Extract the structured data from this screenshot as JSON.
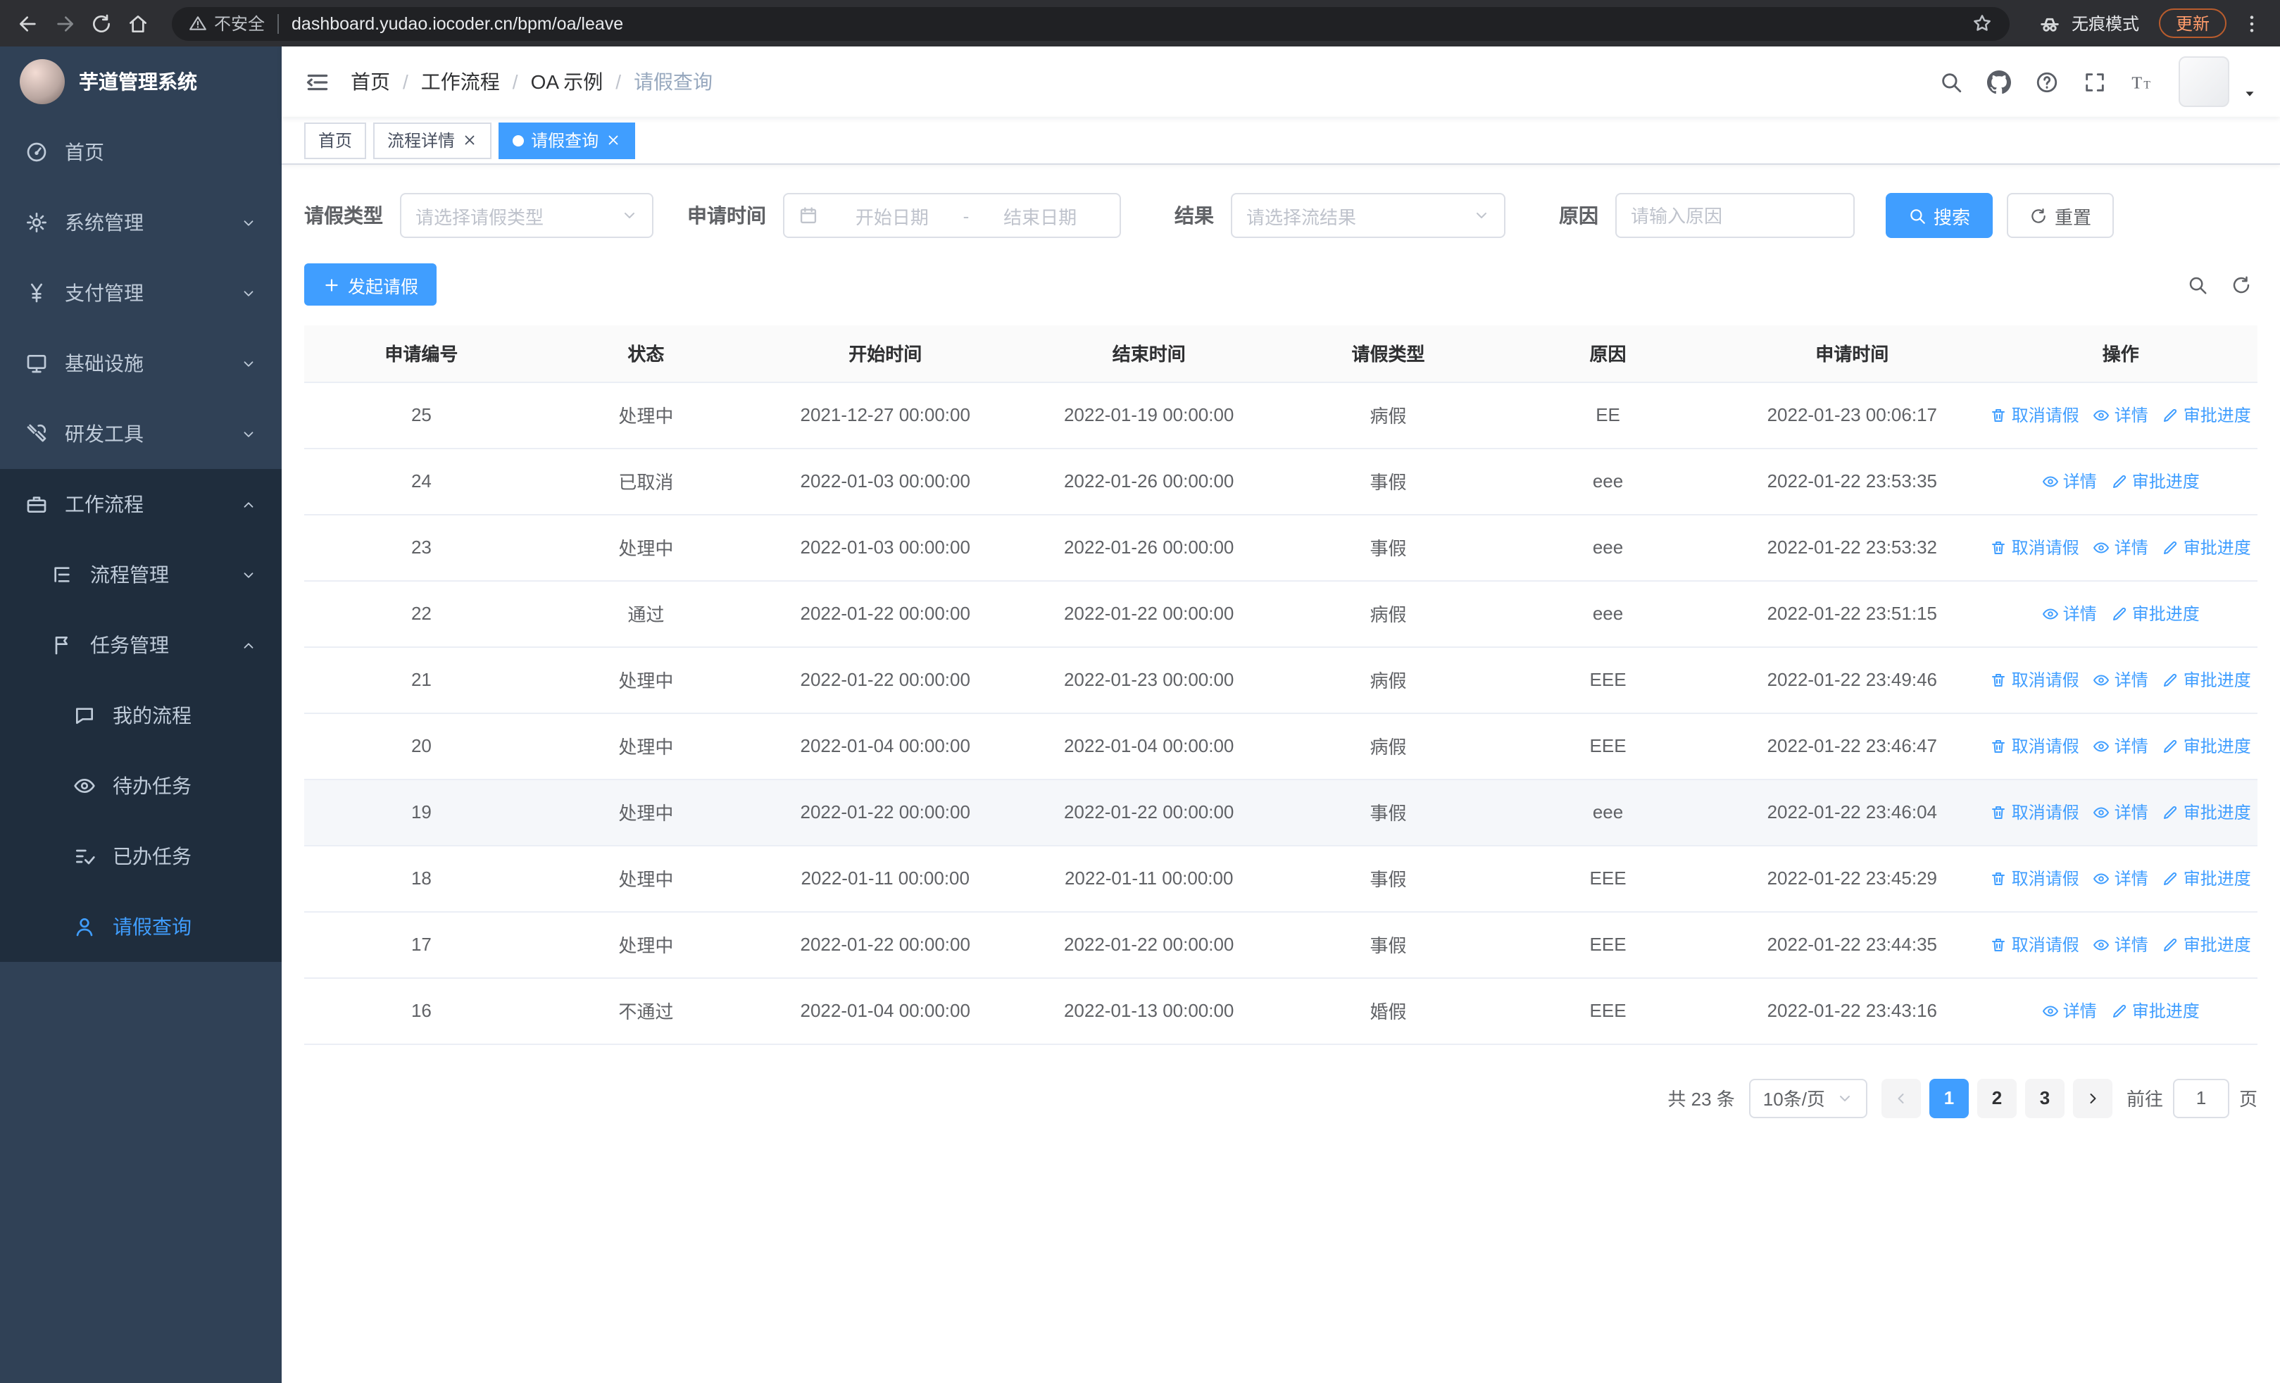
{
  "colors": {
    "primary": "#409eff"
  },
  "browser": {
    "security_warning": "不安全",
    "url": "dashboard.yudao.iocoder.cn/bpm/oa/leave",
    "incognito_label": "无痕模式",
    "update_label": "更新"
  },
  "sidebar": {
    "logo_title": "芋道管理系统",
    "items": [
      {
        "key": "home",
        "label": "首页",
        "icon": "home-icon",
        "level": 1
      },
      {
        "key": "system-mgmt",
        "label": "系统管理",
        "icon": "gear-icon",
        "level": 1,
        "chevron": "down"
      },
      {
        "key": "payment-mgmt",
        "label": "支付管理",
        "icon": "yen-icon",
        "level": 1,
        "chevron": "down"
      },
      {
        "key": "infrastructure",
        "label": "基础设施",
        "icon": "monitor-icon",
        "level": 1,
        "chevron": "down"
      },
      {
        "key": "dev-tools",
        "label": "研发工具",
        "icon": "tools-icon",
        "level": 1,
        "chevron": "down"
      },
      {
        "key": "workflow",
        "label": "工作流程",
        "icon": "briefcase-icon",
        "level": 1,
        "chevron": "up",
        "submenu": true
      },
      {
        "key": "process-mgmt",
        "label": "流程管理",
        "icon": "tree-icon",
        "level": 2,
        "chevron": "down",
        "submenu": true
      },
      {
        "key": "task-mgmt",
        "label": "任务管理",
        "icon": "flag-icon",
        "level": 2,
        "chevron": "up",
        "submenu": true
      },
      {
        "key": "my-process",
        "label": "我的流程",
        "icon": "chat-icon",
        "level": 3,
        "submenu": true
      },
      {
        "key": "todo-tasks",
        "label": "待办任务",
        "icon": "eye-icon",
        "level": 3,
        "submenu": true
      },
      {
        "key": "done-tasks",
        "label": "已办任务",
        "icon": "finished-icon",
        "level": 3,
        "submenu": true
      },
      {
        "key": "leave-query",
        "label": "请假查询",
        "icon": "user-icon",
        "level": 3,
        "submenu": true,
        "active": true
      }
    ]
  },
  "header": {
    "breadcrumbs": [
      "首页",
      "工作流程",
      "OA 示例",
      "请假查询"
    ]
  },
  "tabs": [
    {
      "label": "首页",
      "closable": false,
      "active": false
    },
    {
      "label": "流程详情",
      "closable": true,
      "active": false
    },
    {
      "label": "请假查询",
      "closable": true,
      "active": true
    }
  ],
  "filters": {
    "leave_type_label": "请假类型",
    "leave_type_placeholder": "请选择请假类型",
    "apply_time_label": "申请时间",
    "start_date_placeholder": "开始日期",
    "date_separator": "-",
    "end_date_placeholder": "结束日期",
    "result_label": "结果",
    "result_placeholder": "请选择流结果",
    "reason_label": "原因",
    "reason_placeholder": "请输入原因",
    "search_button": "搜索",
    "reset_button": "重置"
  },
  "toolbar": {
    "create_button": "发起请假"
  },
  "table": {
    "columns": [
      "申请编号",
      "状态",
      "开始时间",
      "结束时间",
      "请假类型",
      "原因",
      "申请时间",
      "操作"
    ],
    "action_meta": {
      "取消请假": {
        "icon": "delete-icon",
        "name": "cancel-leave-action"
      },
      "详情": {
        "icon": "view-icon",
        "name": "detail-action"
      },
      "审批进度": {
        "icon": "edit-icon",
        "name": "approval-progress-action"
      }
    },
    "rows": [
      {
        "id": "25",
        "status": "处理中",
        "start": "2021-12-27 00:00:00",
        "end": "2022-01-19 00:00:00",
        "type": "病假",
        "reason": "EE",
        "applied": "2022-01-23 00:06:17",
        "actions": [
          "取消请假",
          "详情",
          "审批进度"
        ]
      },
      {
        "id": "24",
        "status": "已取消",
        "start": "2022-01-03 00:00:00",
        "end": "2022-01-26 00:00:00",
        "type": "事假",
        "reason": "eee",
        "applied": "2022-01-22 23:53:35",
        "actions": [
          "详情",
          "审批进度"
        ]
      },
      {
        "id": "23",
        "status": "处理中",
        "start": "2022-01-03 00:00:00",
        "end": "2022-01-26 00:00:00",
        "type": "事假",
        "reason": "eee",
        "applied": "2022-01-22 23:53:32",
        "actions": [
          "取消请假",
          "详情",
          "审批进度"
        ]
      },
      {
        "id": "22",
        "status": "通过",
        "start": "2022-01-22 00:00:00",
        "end": "2022-01-22 00:00:00",
        "type": "病假",
        "reason": "eee",
        "applied": "2022-01-22 23:51:15",
        "actions": [
          "详情",
          "审批进度"
        ]
      },
      {
        "id": "21",
        "status": "处理中",
        "start": "2022-01-22 00:00:00",
        "end": "2022-01-23 00:00:00",
        "type": "病假",
        "reason": "EEE",
        "applied": "2022-01-22 23:49:46",
        "actions": [
          "取消请假",
          "详情",
          "审批进度"
        ]
      },
      {
        "id": "20",
        "status": "处理中",
        "start": "2022-01-04 00:00:00",
        "end": "2022-01-04 00:00:00",
        "type": "病假",
        "reason": "EEE",
        "applied": "2022-01-22 23:46:47",
        "actions": [
          "取消请假",
          "详情",
          "审批进度"
        ]
      },
      {
        "id": "19",
        "status": "处理中",
        "start": "2022-01-22 00:00:00",
        "end": "2022-01-22 00:00:00",
        "type": "事假",
        "reason": "eee",
        "applied": "2022-01-22 23:46:04",
        "actions": [
          "取消请假",
          "详情",
          "审批进度"
        ],
        "highlighted": true
      },
      {
        "id": "18",
        "status": "处理中",
        "start": "2022-01-11 00:00:00",
        "end": "2022-01-11 00:00:00",
        "type": "事假",
        "reason": "EEE",
        "applied": "2022-01-22 23:45:29",
        "actions": [
          "取消请假",
          "详情",
          "审批进度"
        ]
      },
      {
        "id": "17",
        "status": "处理中",
        "start": "2022-01-22 00:00:00",
        "end": "2022-01-22 00:00:00",
        "type": "事假",
        "reason": "EEE",
        "applied": "2022-01-22 23:44:35",
        "actions": [
          "取消请假",
          "详情",
          "审批进度"
        ]
      },
      {
        "id": "16",
        "status": "不通过",
        "start": "2022-01-04 00:00:00",
        "end": "2022-01-13 00:00:00",
        "type": "婚假",
        "reason": "EEE",
        "applied": "2022-01-22 23:43:16",
        "actions": [
          "详情",
          "审批进度"
        ]
      }
    ]
  },
  "pagination": {
    "total_text": "共 23 条",
    "page_size": "10条/页",
    "pages": [
      "1",
      "2",
      "3"
    ],
    "active_page": "1",
    "goto_label": "前往",
    "goto_value": "1",
    "goto_suffix": "页"
  }
}
